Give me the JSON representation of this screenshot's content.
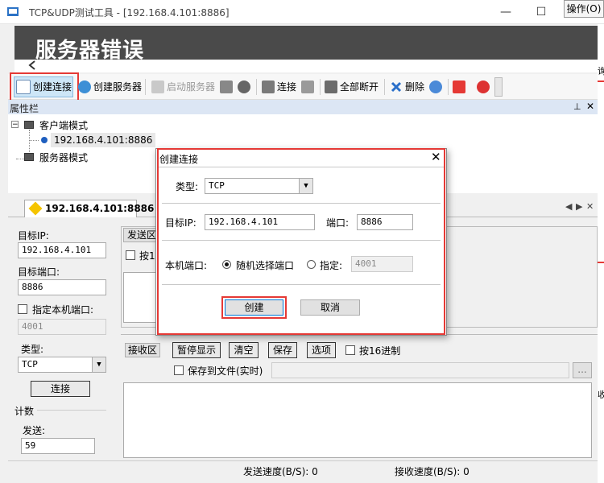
{
  "window": {
    "title": "TCP&UDP测试工具 - [192.168.4.101:8886]",
    "ops_label": "操作(O)",
    "minimize": "—",
    "maximize": "☐"
  },
  "banner": {
    "title": "服务器错误"
  },
  "toolbar": {
    "create_connection": "创建连接",
    "create_server": "创建服务器",
    "start_server": "启动服务器",
    "connect": "连接",
    "disconnect_all": "全部断开",
    "delete": "删除"
  },
  "properties": {
    "title": "属性栏",
    "tree": [
      {
        "label": "客户端模式"
      },
      {
        "label": "192.168.4.101:8886"
      },
      {
        "label": "服务器模式"
      }
    ]
  },
  "tab": {
    "label": "192.168.4.101:8886"
  },
  "left_panel": {
    "target_ip_label": "目标IP:",
    "target_ip_value": "192.168.4.101",
    "target_port_label": "目标端口:",
    "target_port_value": "8886",
    "local_port_label": "指定本机端口:",
    "local_port_value": "4001",
    "type_label": "类型:",
    "type_value": "TCP",
    "connect_label": "连接",
    "count_label": "计数",
    "send_label": "发送:",
    "send_value": "59"
  },
  "send_area": {
    "tab_label": "发送区",
    "hex_label": "按16"
  },
  "receive_area": {
    "tab_label": "接收区",
    "pause_label": "暂停显示",
    "clear_label": "清空",
    "save_label": "保存",
    "options_label": "选项",
    "hex_label": "按16进制",
    "save_file_label": "保存到文件(实时)",
    "browse_label": "..."
  },
  "status": {
    "send_speed": "发送速度(B/S): 0",
    "recv_speed": "接收速度(B/S): 0"
  },
  "dialog": {
    "title": "创建连接",
    "type_label": "类型:",
    "type_value": "TCP",
    "target_ip_label": "目标IP:",
    "target_ip_value": "192.168.4.101",
    "port_label": "端口:",
    "port_value": "8886",
    "local_port_label": "本机端口:",
    "random_port_label": "随机选择端口",
    "specify_label": "指定:",
    "specify_value": "4001",
    "create_label": "创建",
    "cancel_label": "取消"
  },
  "right_edge": {
    "label_top": "询",
    "label_mid": "收"
  },
  "colors": {
    "highlight": "#e53935",
    "banner": "#4a4a4a",
    "selection": "#cde6f7"
  }
}
